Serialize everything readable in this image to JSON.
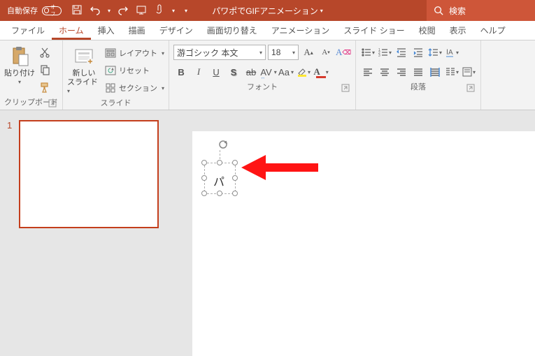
{
  "title_bar": {
    "autosave_label": "自動保存",
    "autosave_state": "オフ",
    "doc_title": "パワポでGIFアニメーション",
    "search_placeholder": "検索"
  },
  "tabs": {
    "file": "ファイル",
    "home": "ホーム",
    "insert": "挿入",
    "draw": "描画",
    "design": "デザイン",
    "transitions": "画面切り替え",
    "animations": "アニメーション",
    "slideshow": "スライド ショー",
    "review": "校閲",
    "view": "表示",
    "help": "ヘルプ"
  },
  "ribbon": {
    "clipboard": {
      "paste": "貼り付け",
      "label": "クリップボード"
    },
    "slides": {
      "new_slide_l1": "新しい",
      "new_slide_l2": "スライド",
      "layout": "レイアウト",
      "reset": "リセット",
      "section": "セクション",
      "label": "スライド"
    },
    "font": {
      "name": "游ゴシック 本文",
      "size": "18",
      "bold": "B",
      "italic": "I",
      "underline": "U",
      "shadow": "S",
      "strike": "ab",
      "spacing": "AV",
      "case": "Aa",
      "label": "フォント"
    },
    "paragraph": {
      "label": "段落"
    }
  },
  "thumbnail": {
    "number": "1"
  },
  "slide": {
    "textbox_content": "パ"
  }
}
